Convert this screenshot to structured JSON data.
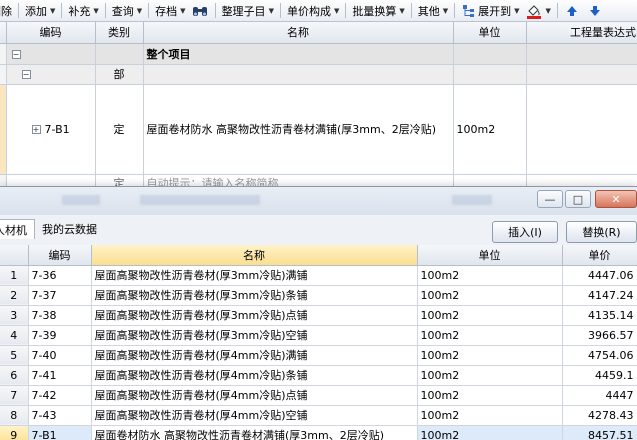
{
  "toolbar": {
    "items": [
      {
        "label": "删除",
        "caret": false
      },
      {
        "label": "添加",
        "caret": true
      },
      {
        "label": "补充",
        "caret": true
      },
      {
        "label": "查询",
        "caret": true
      },
      {
        "label": "存档",
        "caret": true
      },
      {
        "label": "整理子目",
        "caret": true
      },
      {
        "label": "单价构成",
        "caret": true
      },
      {
        "label": "批量换算",
        "caret": true
      },
      {
        "label": "其他",
        "caret": true
      },
      {
        "label": "展开到",
        "caret": true
      }
    ]
  },
  "upper": {
    "columns": [
      "编码",
      "类别",
      "名称",
      "单位",
      "工程量表达式"
    ],
    "rows": [
      {
        "code": "",
        "type": "",
        "name": "整个项目",
        "unit": ""
      },
      {
        "code": "",
        "type": "部",
        "name": "",
        "unit": ""
      },
      {
        "code": "7-B1",
        "type": "定",
        "name": "屋面卷材防水 高聚物改性沥青卷材满铺(厚3mm、2层冷贴)",
        "unit": "100m2"
      },
      {
        "code": "",
        "type": "定",
        "name": "自动提示：请输入名称简称",
        "unit": ""
      }
    ]
  },
  "dialog": {
    "tabs": [
      "人材机",
      "我的云数据"
    ],
    "buttons": {
      "insert": "插入(I)",
      "replace": "替换(R)"
    },
    "columns": [
      "编码",
      "名称",
      "单位",
      "单价"
    ],
    "rows": [
      {
        "n": "1",
        "code": "7-36",
        "name": "屋面高聚物改性沥青卷材(厚3mm冷贴)满铺",
        "unit": "100m2",
        "price": "4447.06"
      },
      {
        "n": "2",
        "code": "7-37",
        "name": "屋面高聚物改性沥青卷材(厚3mm冷贴)条铺",
        "unit": "100m2",
        "price": "4147.24"
      },
      {
        "n": "3",
        "code": "7-38",
        "name": "屋面高聚物改性沥青卷材(厚3mm冷贴)点铺",
        "unit": "100m2",
        "price": "4135.14"
      },
      {
        "n": "4",
        "code": "7-39",
        "name": "屋面高聚物改性沥青卷材(厚3mm冷贴)空铺",
        "unit": "100m2",
        "price": "3966.57"
      },
      {
        "n": "5",
        "code": "7-40",
        "name": "屋面高聚物改性沥青卷材(厚4mm冷贴)满铺",
        "unit": "100m2",
        "price": "4754.06"
      },
      {
        "n": "6",
        "code": "7-41",
        "name": "屋面高聚物改性沥青卷材(厚4mm冷贴)条铺",
        "unit": "100m2",
        "price": "4459.1"
      },
      {
        "n": "7",
        "code": "7-42",
        "name": "屋面高聚物改性沥青卷材(厚4mm冷贴)点铺",
        "unit": "100m2",
        "price": "4447"
      },
      {
        "n": "8",
        "code": "7-43",
        "name": "屋面高聚物改性沥青卷材(厚4mm冷贴)空铺",
        "unit": "100m2",
        "price": "4278.43"
      },
      {
        "n": "9",
        "code": "7-B1",
        "name": "屋面卷材防水 高聚物改性沥青卷材满铺(厚3mm、2层冷贴)",
        "unit": "100m2",
        "price": "8457.51"
      }
    ]
  },
  "colors": {
    "accent": "#0a5fc7",
    "selection": "#ddeafa",
    "header_highlight": "#fbdf8f",
    "active_row": "#fbe6c2"
  }
}
